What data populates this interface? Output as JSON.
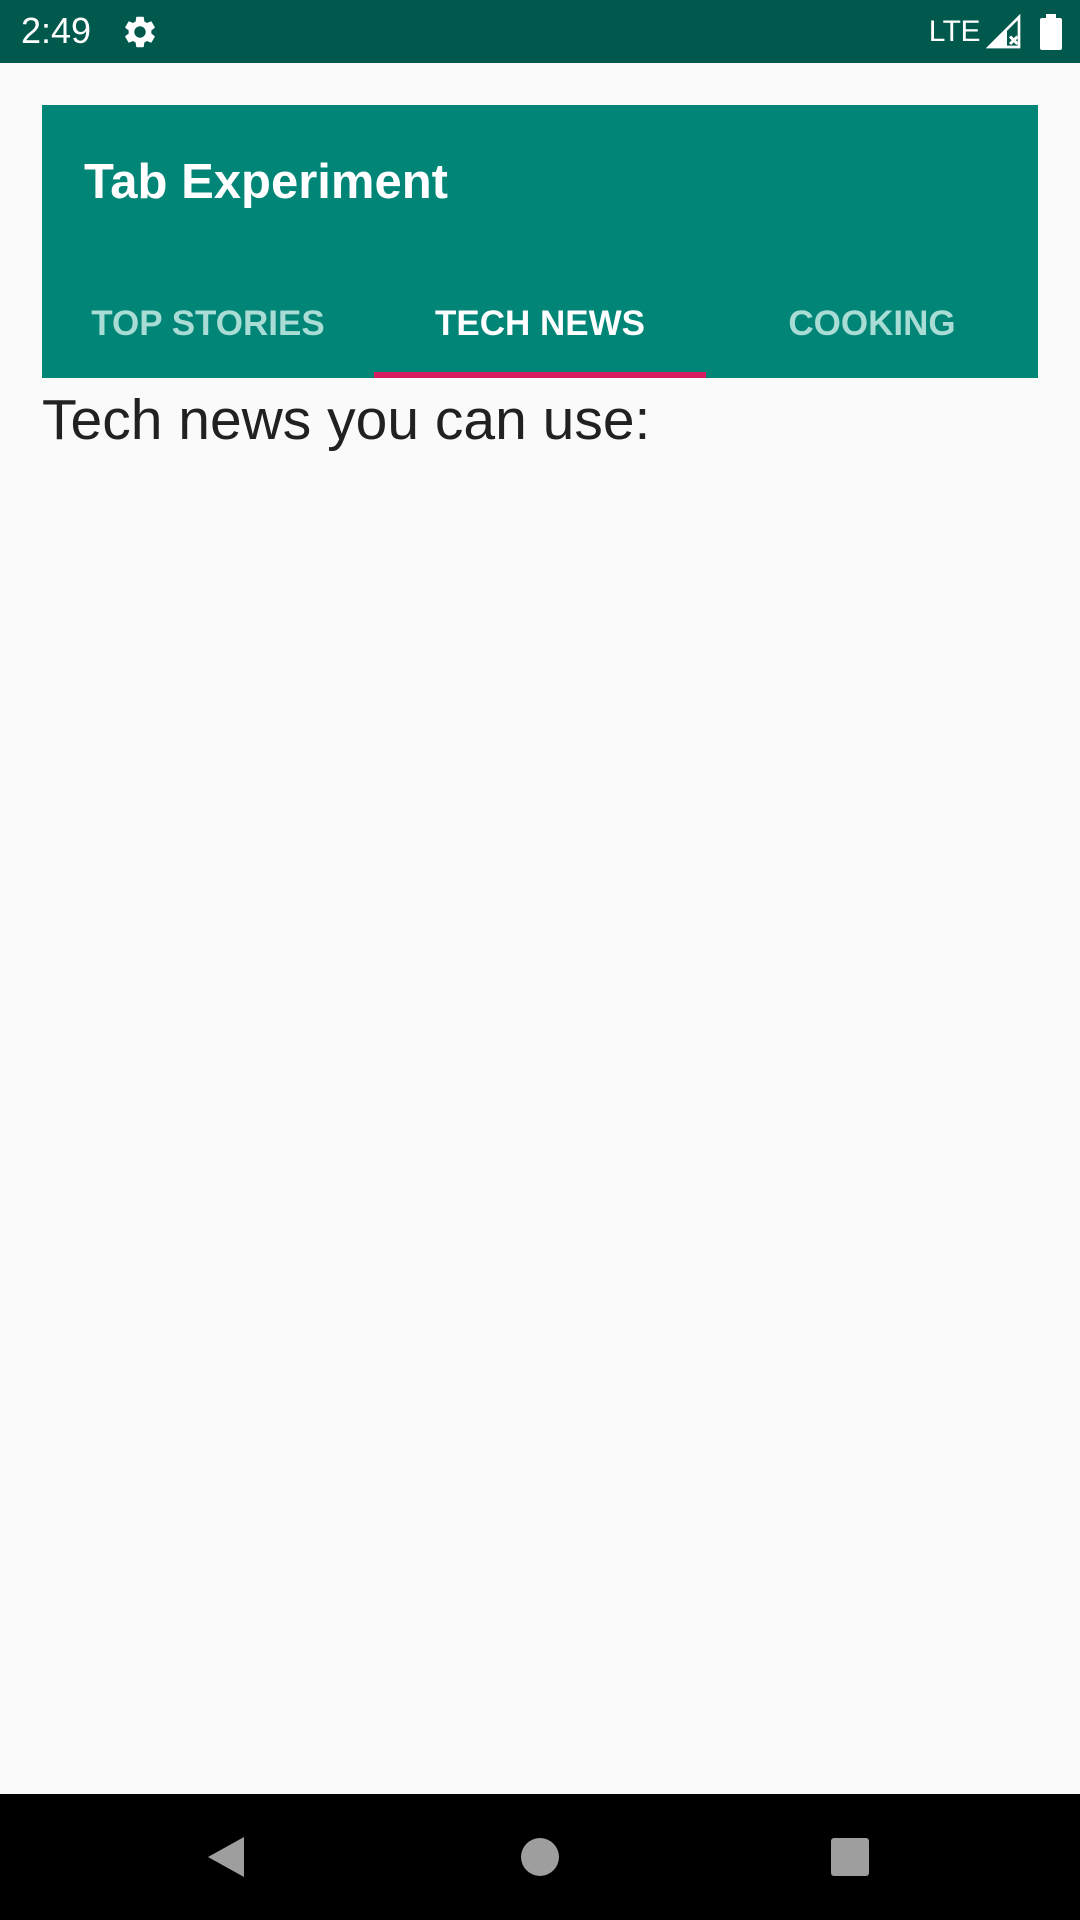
{
  "status_bar": {
    "time": "2:49",
    "network": "LTE",
    "settings_icon": "gear-icon",
    "signal_icon": "signal-no-data-icon",
    "battery_icon": "battery-full-icon",
    "background": "#00594c"
  },
  "app_bar": {
    "title": "Tab Experiment",
    "background": "#008577"
  },
  "tabs": [
    {
      "label": "TOP STORIES",
      "selected": false
    },
    {
      "label": "TECH NEWS",
      "selected": true
    },
    {
      "label": "COOKING",
      "selected": false
    }
  ],
  "tab_indicator_color": "#d81b60",
  "content": {
    "text": "Tech news you can use:"
  },
  "nav_bar": {
    "back_icon": "back-triangle-icon",
    "home_icon": "home-circle-icon",
    "recents_icon": "recents-square-icon"
  }
}
